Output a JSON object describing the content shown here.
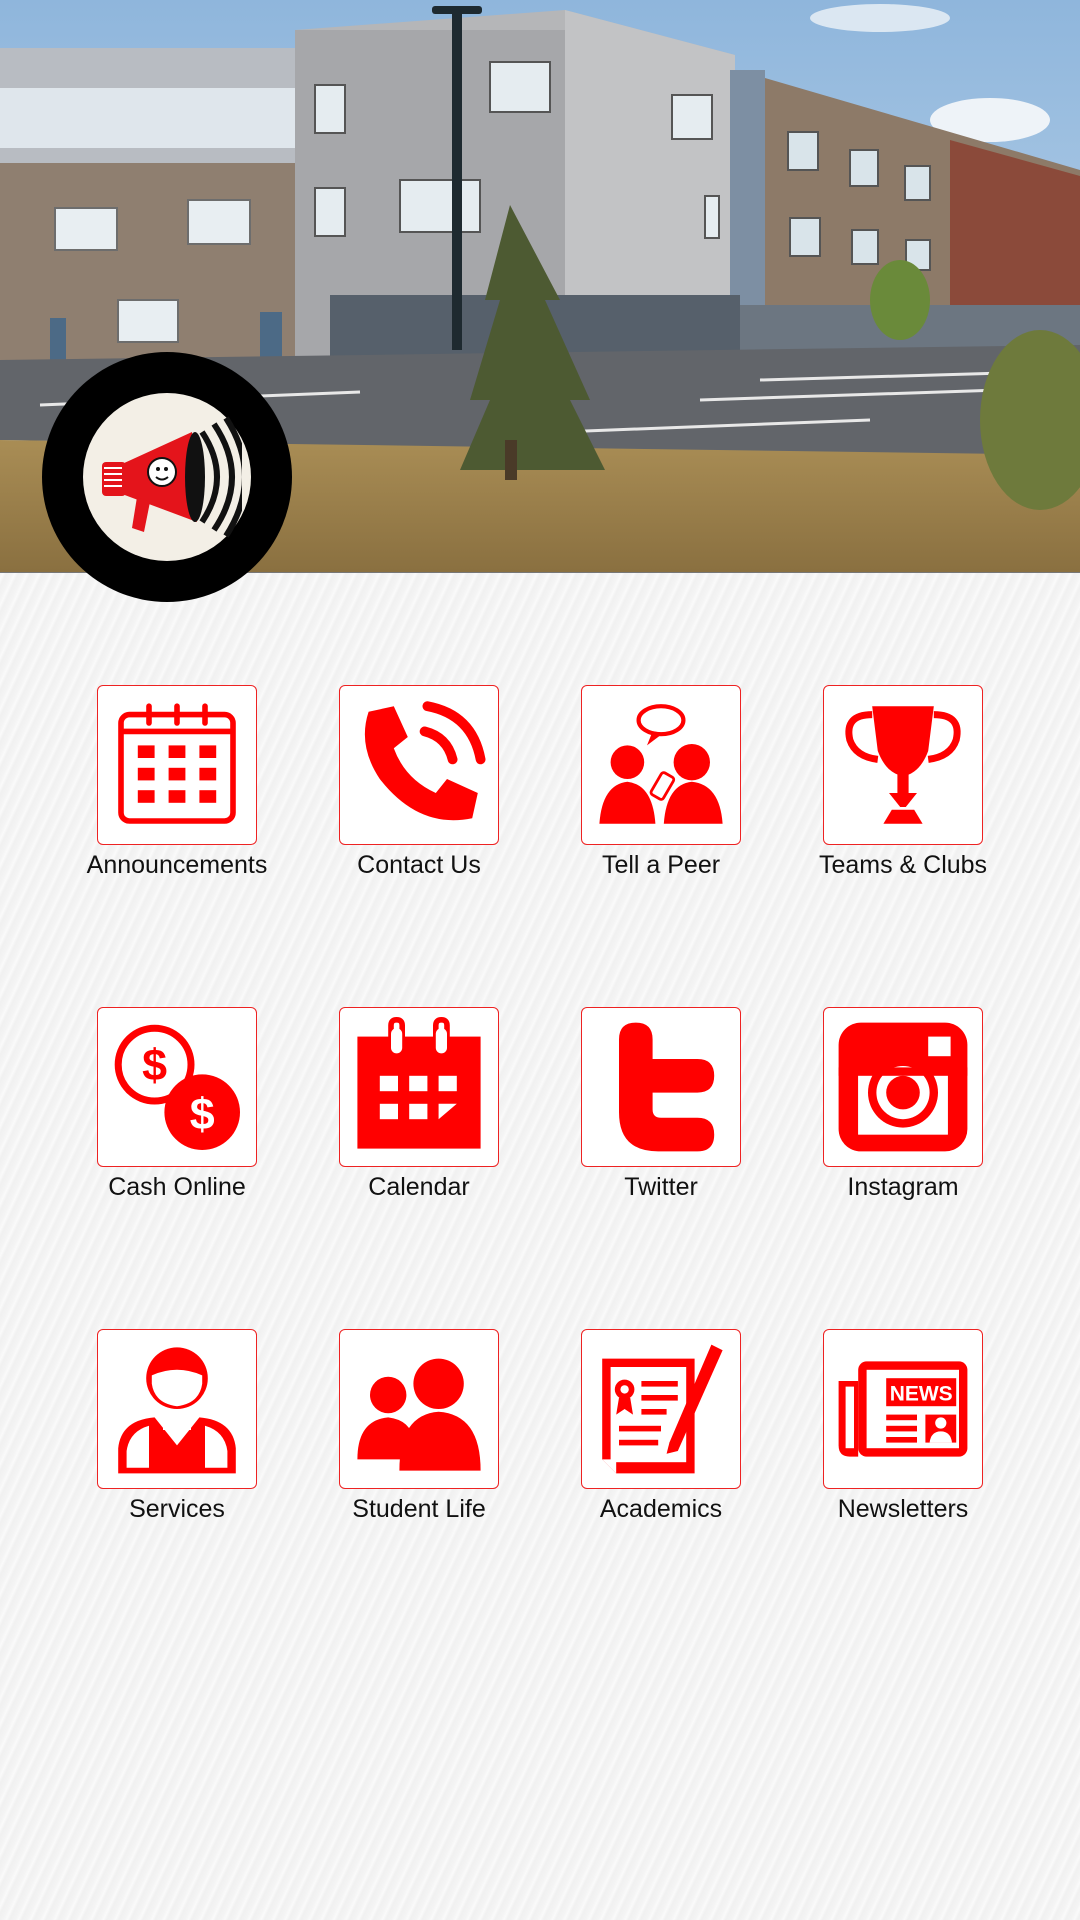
{
  "colors": {
    "accent": "#ff0000",
    "tile_border": "#e22222",
    "label": "#111111"
  },
  "header": {
    "image": "school-building-photo",
    "logo_icon": "megaphone-icon"
  },
  "tiles": [
    {
      "label": "Announcements",
      "icon": "calendar-grid-icon"
    },
    {
      "label": "Contact Us",
      "icon": "phone-icon"
    },
    {
      "label": "Tell a Peer",
      "icon": "people-chat-icon"
    },
    {
      "label": "Teams & Clubs",
      "icon": "trophy-icon"
    },
    {
      "label": "Cash Online",
      "icon": "dollar-coins-icon"
    },
    {
      "label": "Calendar",
      "icon": "calendar-icon"
    },
    {
      "label": "Twitter",
      "icon": "twitter-icon"
    },
    {
      "label": "Instagram",
      "icon": "instagram-icon"
    },
    {
      "label": "Services",
      "icon": "server-person-icon"
    },
    {
      "label": "Student Life",
      "icon": "group-icon"
    },
    {
      "label": "Academics",
      "icon": "certificate-icon"
    },
    {
      "label": "Newsletters",
      "icon": "newspaper-icon"
    }
  ]
}
